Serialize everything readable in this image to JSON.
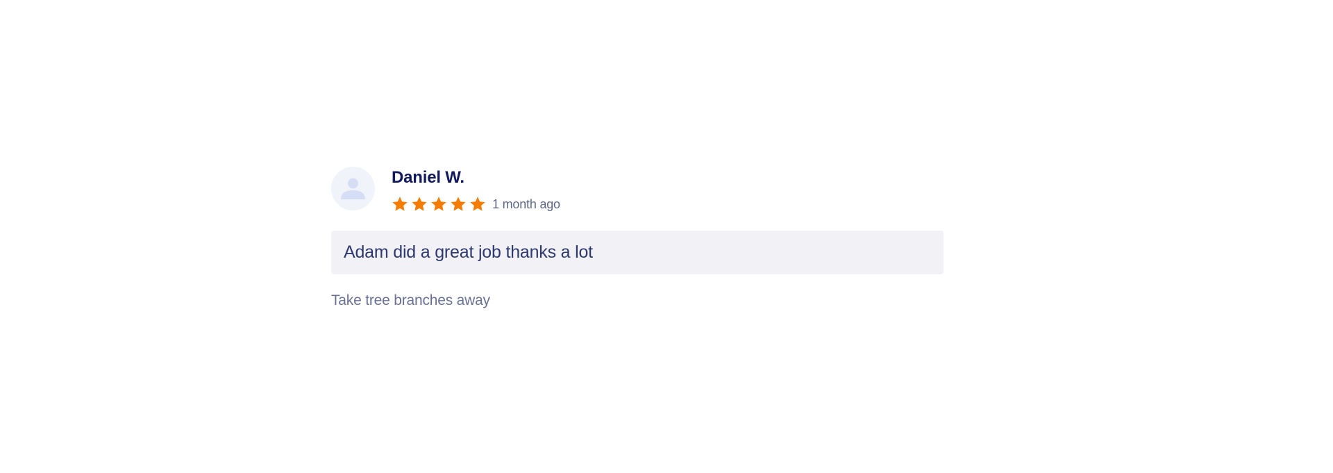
{
  "review": {
    "reviewer_name": "Daniel W.",
    "avatar_icon": "user-icon",
    "rating": 5,
    "rating_max": 5,
    "star_icon": "star-icon",
    "star_color": "#f57c00",
    "time_ago": "1 month ago",
    "comment": "Adam did a great job thanks a lot",
    "job_title": "Take tree branches away"
  }
}
